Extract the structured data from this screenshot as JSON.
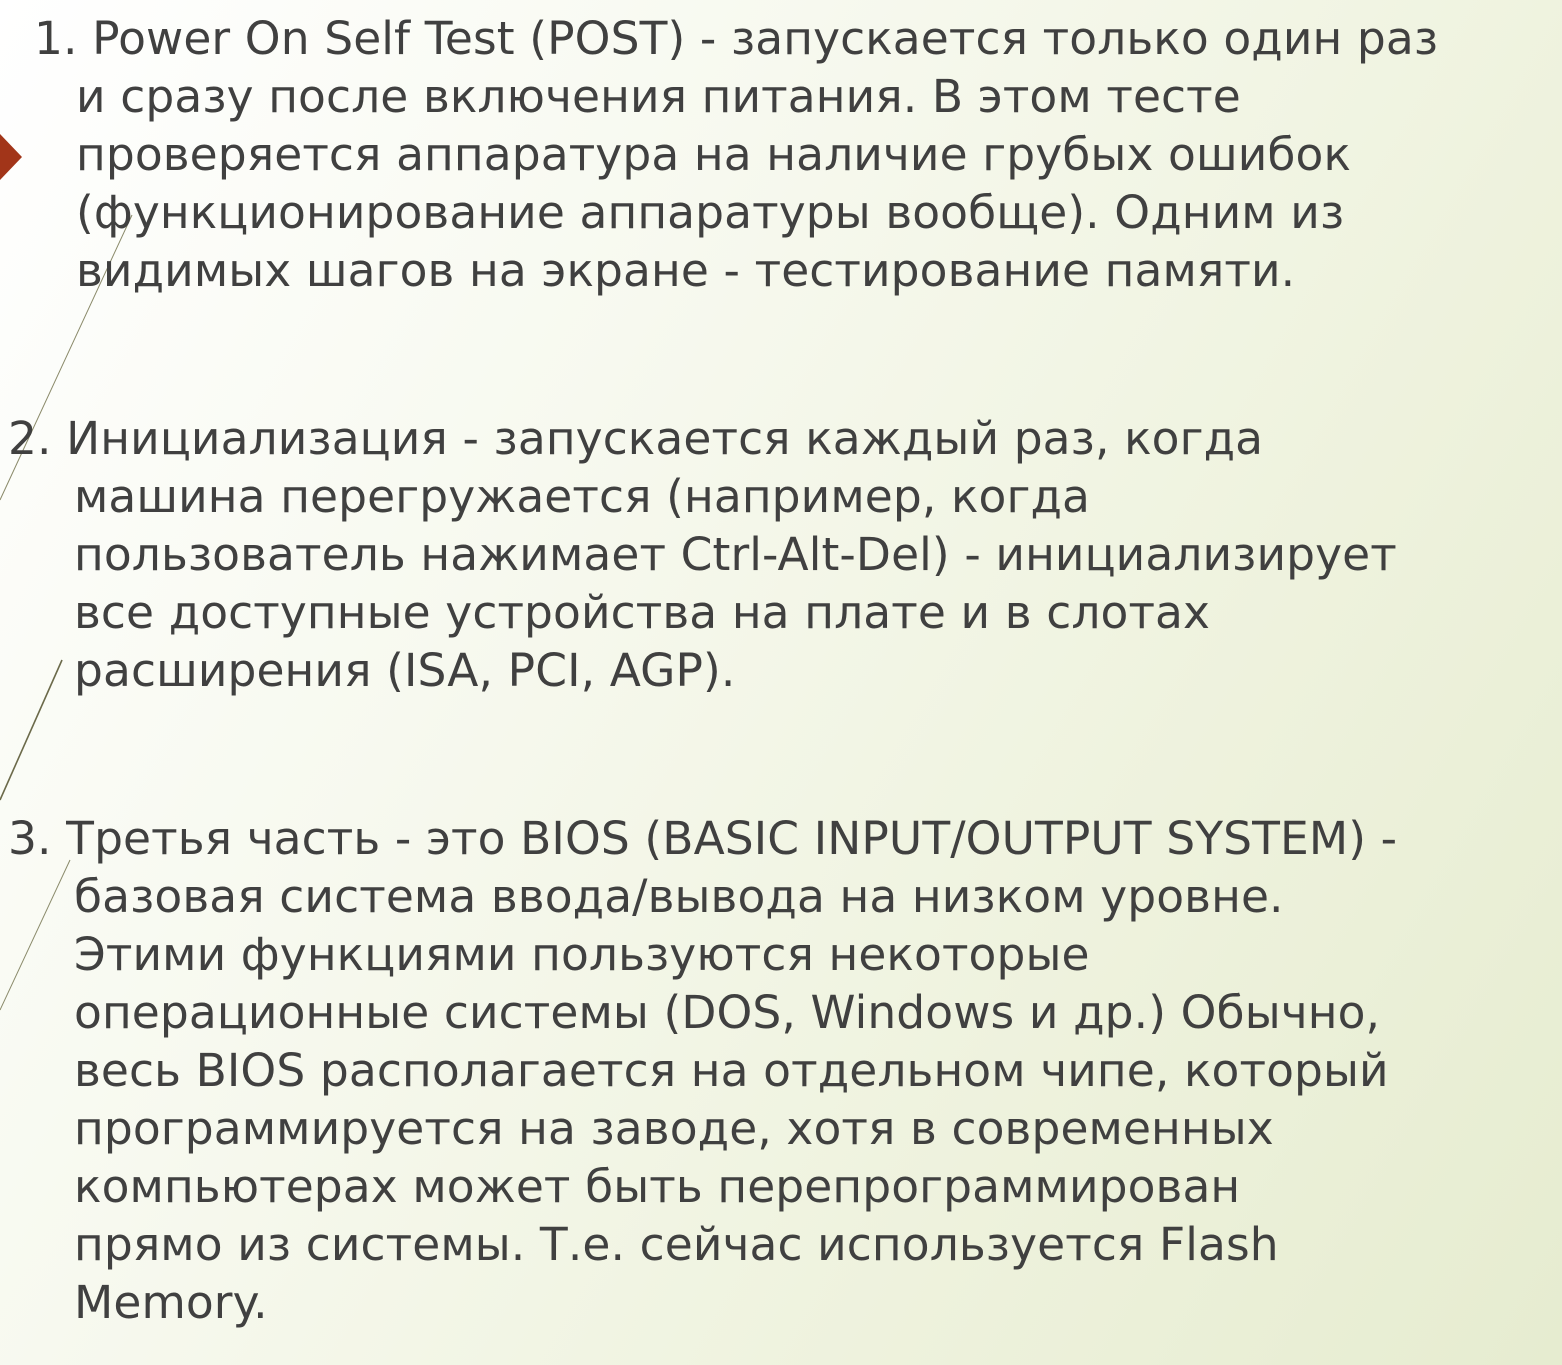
{
  "colors": {
    "text": "#404040",
    "bullet": "#a23519",
    "background_start": "#ffffff",
    "background_end": "#e6ecd0",
    "decor_line": "#6b6a4a"
  },
  "icons": {
    "bullet": "arrow-bullet-icon"
  },
  "paragraphs": [
    {
      "lines": [
        "1. Power On Self Test (POST) - запускается только один раз",
        "и сразу после включения питания. В этом тесте",
        "проверяется аппаратура на наличие грубых ошибок",
        "(функционирование аппаратуры вообще). Одним из",
        "видимых шагов на экране - тестирование памяти."
      ]
    },
    {
      "lines": [
        "2. Инициализация - запускается каждый раз, когда",
        "машина перегружается (например, когда",
        "пользователь нажимает Ctrl-Alt-Del) - инициализирует",
        "все доступные устройства на плате и в слотах",
        "расширения (ISA, PCI, AGP)."
      ]
    },
    {
      "lines": [
        "3. Третья часть - это BIOS (BASIC INPUT/OUTPUT SYSTEM) -",
        "базовая система ввода/вывода на низком уровне.",
        "Этими функциями пользуются некоторые",
        "операционные системы (DOS, Windows и др.) Обычно,",
        "весь BIOS располагается на отдельном чипе, который",
        "программируется на заводе, хотя в современных",
        "компьютерах может быть перепрограммирован",
        "прямо из системы. Т.е. сейчас используется Flash",
        "Memory."
      ]
    }
  ]
}
